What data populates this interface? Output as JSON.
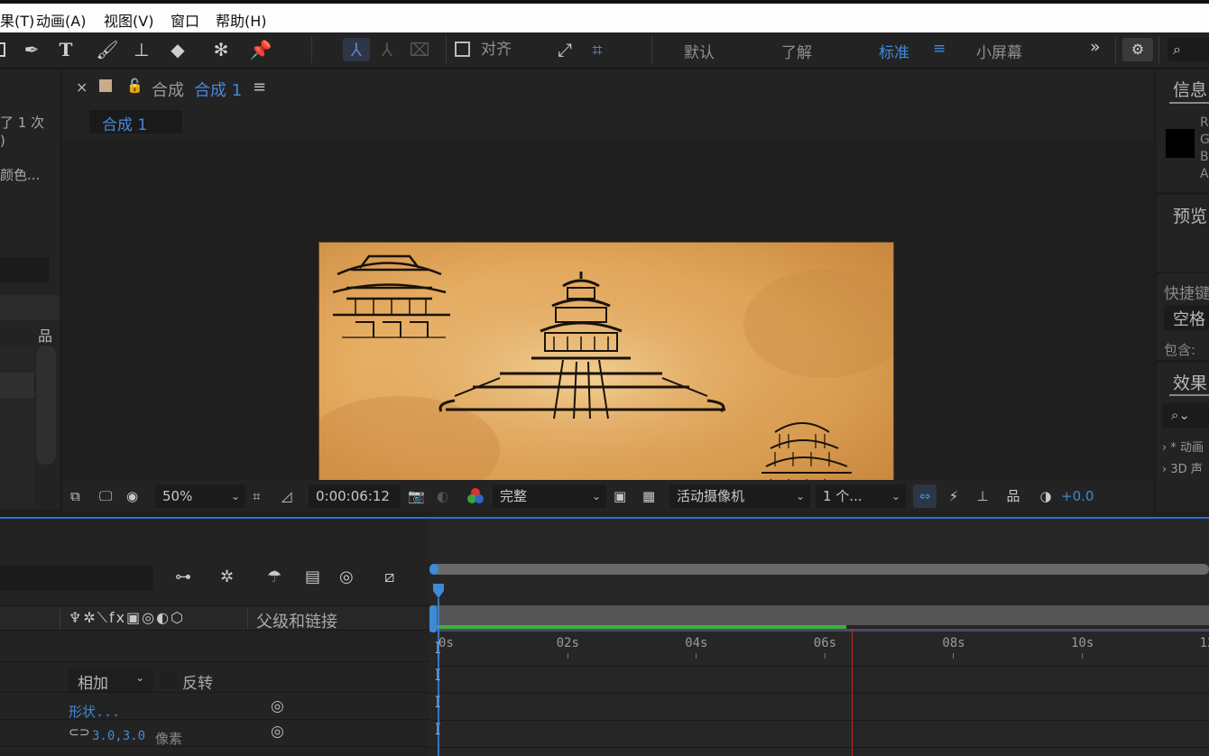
{
  "menu": {
    "items": [
      "果(T)",
      "动画(A)",
      "视图(V)",
      "窗口",
      "帮助(H)"
    ]
  },
  "toolbar": {
    "align_label": "对齐",
    "workspaces": [
      "默认",
      "了解",
      "标准",
      "小屏幕"
    ],
    "active_workspace": "标准",
    "workspace_menu": "≡",
    "more": "»"
  },
  "left_panel": {
    "text1": "了 1 次",
    "text2": ")",
    "text3": "颜色..."
  },
  "comp_panel": {
    "close": "×",
    "tab_prefix": "合成",
    "tab_name": "合成 1",
    "menu": "≡",
    "breadcrumb": "合成 1"
  },
  "viewer_bar": {
    "zoom": "50%",
    "timecode": "0:00:06:12",
    "resolution": "完整",
    "camera": "活动摄像机",
    "views": "1 个...",
    "exposure": "+0.0"
  },
  "right_panel": {
    "info_title": "信息",
    "channels": [
      "R",
      "G",
      "B",
      "A"
    ],
    "preview_title": "预览",
    "shortcut_label": "快捷键",
    "shortcut_value": "空格",
    "include_label": "包含:",
    "effects_title": "效果",
    "effects_items": [
      "* 动画",
      "3D 声"
    ]
  },
  "timeline": {
    "parent_link_label": "父级和链接",
    "blend_mode": "相加",
    "invert_label": "反转",
    "shape_link": "形状...",
    "stroke_value": "3.0,3.0",
    "stroke_unit": "像素",
    "time_ticks": [
      "0s",
      "02s",
      "04s",
      "06s",
      "08s",
      "10s",
      "12"
    ],
    "current_time_seconds": 6.5,
    "work_area_end_seconds": 6.4
  },
  "colors": {
    "accent_blue": "#2e6fd8",
    "workspace_active": "#3f8ad8",
    "work_area_green": "#3fb03f",
    "playhead_red": "#c0282a",
    "comp_tab_blue": "#4a86d8"
  }
}
